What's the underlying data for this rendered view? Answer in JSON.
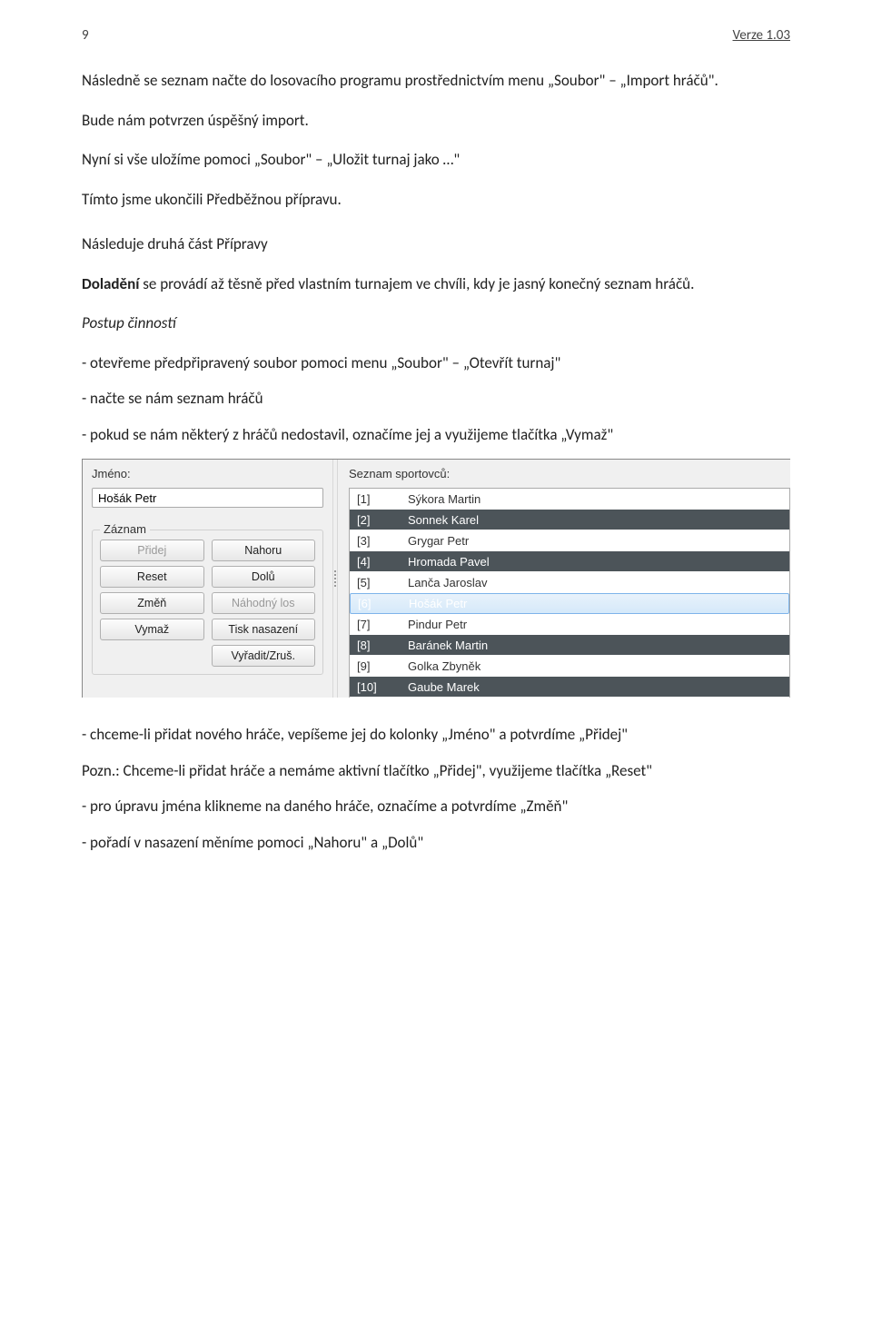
{
  "header": {
    "page": "9",
    "version": "Verze 1.03"
  },
  "para": {
    "p1": "Následně se seznam načte do losovacího programu prostřednictvím menu „Soubor\" – „Import hráčů\".",
    "p2": "Bude nám potvrzen úspěšný import.",
    "p3": "Nyní si vše uložíme pomoci „Soubor\" – „Uložit turnaj jako …\"",
    "p4": "Tímto jsme ukončili Předběžnou přípravu.",
    "p5": "Následuje druhá část Přípravy",
    "p6a": "Doladění",
    "p6b": " se provádí až těsně před vlastním turnajem ve chvíli, kdy je jasný konečný seznam hráčů.",
    "p7": "Postup činností",
    "l1": "- otevřeme předpřipravený soubor pomoci menu „Soubor\" – „Otevřít turnaj\"",
    "l2": "- načte se nám seznam hráčů",
    "l3": "- pokud se nám některý z hráčů nedostavil, označíme jej a využijeme tlačítka „Vymaž\"",
    "p8": "- chceme-li přidat nového hráče, vepíšeme jej do kolonky „Jméno\" a potvrdíme „Přidej\"",
    "p9": "Pozn.: Chceme-li přidat hráče a nemáme aktivní tlačítko „Přidej\", využijeme tlačítka „Reset\"",
    "l4": "- pro úpravu jména klikneme na daného hráče, označíme a potvrdíme „Změň\"",
    "l5": "- pořadí v nasazení měníme pomoci „Nahoru\" a „Dolů\""
  },
  "shot": {
    "jmeno_label": "Jméno:",
    "jmeno_value": "Hošák Petr",
    "zaznam_label": "Záznam",
    "seznam_label": "Seznam sportovců:",
    "buttons": {
      "pridej": "Přidej",
      "nahoru": "Nahoru",
      "reset": "Reset",
      "dolu": "Dolů",
      "zmen": "Změň",
      "nahodny": "Náhodný los",
      "vymaz": "Vymaž",
      "tisk": "Tisk nasazení",
      "vyradit": "Vyřadit/Zruš."
    },
    "players": [
      {
        "rank": "[1]",
        "name": "Sýkora Martin"
      },
      {
        "rank": "[2]",
        "name": "Sonnek Karel"
      },
      {
        "rank": "[3]",
        "name": "Grygar Petr"
      },
      {
        "rank": "[4]",
        "name": "Hromada Pavel"
      },
      {
        "rank": "[5]",
        "name": "Lanča Jaroslav"
      },
      {
        "rank": "[6]",
        "name": "Hošák Petr"
      },
      {
        "rank": "[7]",
        "name": "Pindur Petr"
      },
      {
        "rank": "[8]",
        "name": "Baránek Martin"
      },
      {
        "rank": "[9]",
        "name": "Golka Zbyněk"
      },
      {
        "rank": "[10]",
        "name": "Gaube Marek"
      }
    ],
    "selected_index": 5
  }
}
